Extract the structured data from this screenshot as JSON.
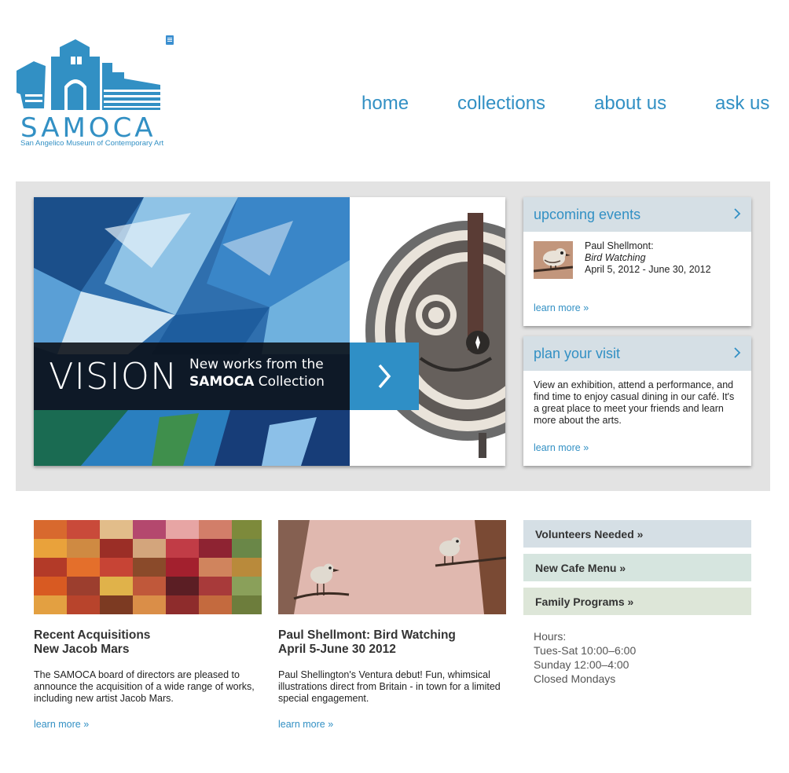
{
  "logo": {
    "name": "SAMOCA",
    "subtitle": "San Angelico Museum of Contemporary Art"
  },
  "nav": [
    "home",
    "collections",
    "about us",
    "ask us"
  ],
  "hero": {
    "title": "VISION",
    "subtitle_line1": "New works from the",
    "subtitle_bold": "SAMOCA",
    "subtitle_line2": " Collection"
  },
  "events": {
    "heading": "upcoming events",
    "artist": "Paul Shellmont:",
    "title": "Bird Watching",
    "dates": "April 5, 2012 - June 30, 2012",
    "learn_more": "learn more »"
  },
  "visit": {
    "heading": "plan your visit",
    "body": "View an exhibition, attend a performance, and find time to enjoy casual dining in our café. It's a great place to meet your friends and learn more about the arts.",
    "learn_more": "learn more »"
  },
  "tiles": [
    {
      "title1": "Recent Acquisitions",
      "title2": "New Jacob Mars",
      "desc": "The SAMOCA board of directors are pleased to announce the acquisition of a wide range of works, including new artist Jacob Mars.",
      "learn_more": "learn more »"
    },
    {
      "title1": "Paul Shellmont: Bird Watching",
      "title2": "April 5-June 30 2012",
      "desc": "Paul Shellington's Ventura debut! Fun, whimsical illustrations direct from Britain - in town for a limited special engagement.",
      "learn_more": "learn more »"
    }
  ],
  "side_links": [
    {
      "label": "Volunteers Needed »",
      "color": "#d5dfe5"
    },
    {
      "label": "New Cafe Menu »",
      "color": "#d6e5df"
    },
    {
      "label": "Family Programs »",
      "color": "#dde6d8"
    }
  ],
  "hours": [
    "Hours:",
    "Tues-Sat 10:00–6:00",
    "Sunday 12:00–4:00",
    "Closed Mondays"
  ],
  "colors": {
    "accent": "#3290c4",
    "band": "#e3e3e3",
    "card_head": "#d5dfe5"
  }
}
